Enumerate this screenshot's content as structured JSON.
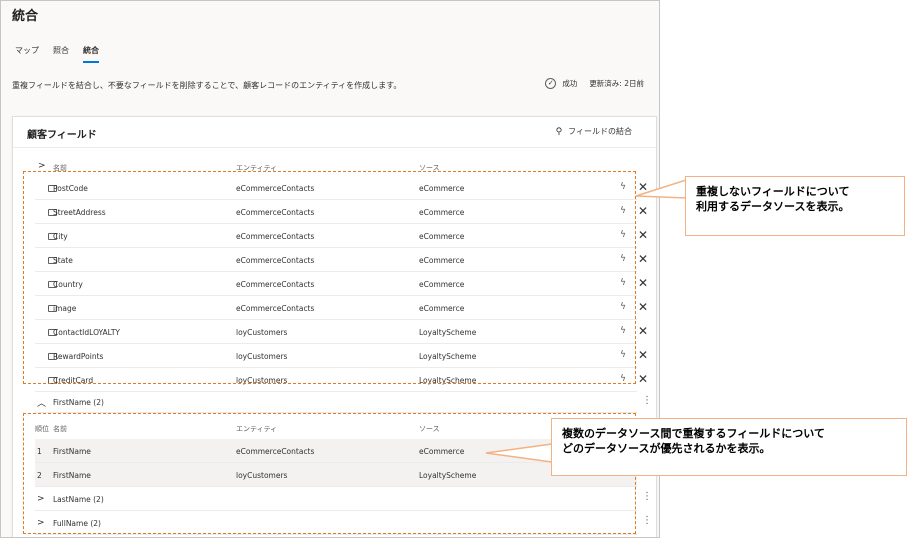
{
  "page": {
    "title": "統合",
    "tabs": [
      {
        "label": "マップ",
        "active": false
      },
      {
        "label": "照合",
        "active": false
      },
      {
        "label": "統合",
        "active": true
      }
    ],
    "description": "重複フィールドを結合し、不要なフィールドを削除することで、顧客レコードのエンティティを作成します。",
    "status": {
      "label": "成功",
      "updated": "更新済み: 2日前",
      "icon": "check-circle-icon"
    }
  },
  "card": {
    "title": "顧客フィールド",
    "merge_fields_label": "フィールドの結合",
    "merge_fields_icon": "merge-icon",
    "columns": {
      "name": "名前",
      "entity": "エンティティ",
      "source": "ソース"
    },
    "rows": [
      {
        "name": "PostCode",
        "entity": "eCommerceContacts",
        "source": "eCommerce"
      },
      {
        "name": "StreetAddress",
        "entity": "eCommerceContacts",
        "source": "eCommerce"
      },
      {
        "name": "City",
        "entity": "eCommerceContacts",
        "source": "eCommerce"
      },
      {
        "name": "State",
        "entity": "eCommerceContacts",
        "source": "eCommerce"
      },
      {
        "name": "Country",
        "entity": "eCommerceContacts",
        "source": "eCommerce"
      },
      {
        "name": "image",
        "entity": "eCommerceContacts",
        "source": "eCommerce"
      },
      {
        "name": "ContactIdLOYALTY",
        "entity": "loyCustomers",
        "source": "LoyaltyScheme"
      },
      {
        "name": "RewardPoints",
        "entity": "loyCustomers",
        "source": "LoyaltyScheme"
      },
      {
        "name": "CreditCard",
        "entity": "loyCustomers",
        "source": "LoyaltyScheme"
      }
    ],
    "groups": [
      {
        "label": "FirstName (2)",
        "expanded": true,
        "columns": {
          "rank": "順位",
          "name": "名前",
          "entity": "エンティティ",
          "source": "ソース"
        },
        "rows": [
          {
            "rank": "1",
            "name": "FirstName",
            "entity": "eCommerceContacts",
            "source": "eCommerce"
          },
          {
            "rank": "2",
            "name": "FirstName",
            "entity": "loyCustomers",
            "source": "LoyaltyScheme"
          }
        ]
      },
      {
        "label": "LastName (2)",
        "expanded": false
      },
      {
        "label": "FullName (2)",
        "expanded": false
      }
    ]
  },
  "annotations": {
    "callout1": {
      "line1": "重複しないフィールドについて",
      "line2": "利用するデータソースを表示。"
    },
    "callout2": {
      "line1": "複数のデータソース間で重複するフィールドについて",
      "line2": "どのデータソースが優先されるかを表示。"
    },
    "color": "#e07b24"
  }
}
